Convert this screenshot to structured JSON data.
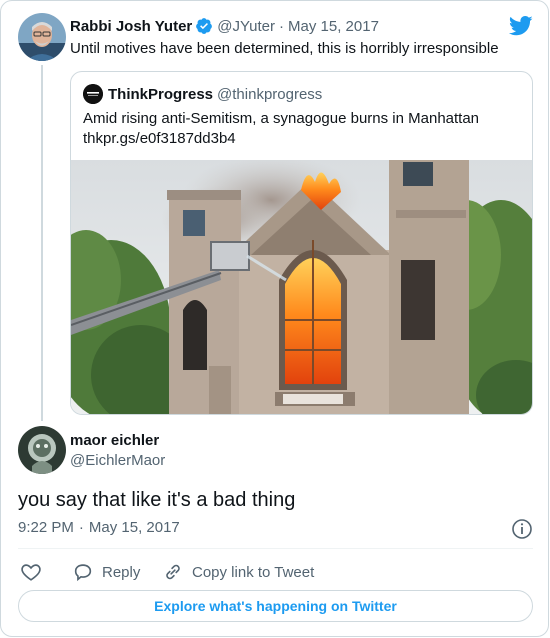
{
  "original_tweet": {
    "author_name": "Rabbi Josh Yuter",
    "handle": "@JYuter",
    "separator": "·",
    "date": "May 15, 2017",
    "text": "Until motives have been determined, this is horribly irresponsible"
  },
  "quoted_tweet": {
    "author_name": "ThinkProgress",
    "handle": "@thinkprogress",
    "text": "Amid rising anti-Semitism, a synagogue burns in Manhattan",
    "link": "thkpr.gs/e0f3187dd3b4"
  },
  "reply_tweet": {
    "author_name": "maor eichler",
    "handle": "@EichlerMaor",
    "text": "you say that like it's a bad thing",
    "time": "9:22 PM",
    "separator": "·",
    "date": "May 15, 2017"
  },
  "actions": {
    "reply_label": "Reply",
    "copy_link_label": "Copy link to Tweet"
  },
  "explore_label": "Explore what's happening on Twitter",
  "colors": {
    "twitter_blue": "#1d9bf0",
    "verified_blue": "#1d9bf0",
    "text_primary": "#0f1419",
    "text_muted": "#536471",
    "border": "#cfd9de"
  }
}
